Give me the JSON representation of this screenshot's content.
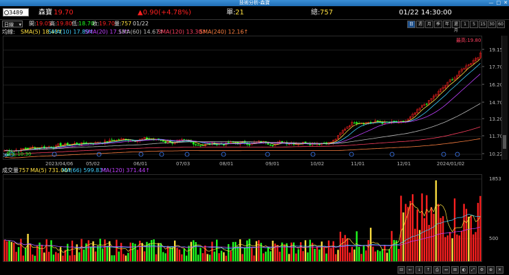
{
  "window": {
    "title": "技術分析-森寶",
    "controls": [
      "—",
      "□",
      "✕"
    ]
  },
  "header": {
    "code": "3489",
    "name": "森寶",
    "price": "19.70",
    "change": "▲0.90(+4.78%)",
    "unit_label": "單:",
    "unit_value": "21",
    "total_label": "總:",
    "total_value": "757",
    "datetime": "01/22 14:30:00"
  },
  "ohlc": {
    "period_select": "日線",
    "open_label": "開:",
    "open": "19.05",
    "high_label": "高:",
    "high": "19.80",
    "low_label": "低:",
    "low": "18.70",
    "close_label": "收:",
    "close": "19.70",
    "volume_label": "量:",
    "volume": "757",
    "date": "01/22"
  },
  "periods": [
    "日",
    "週",
    "月",
    "季",
    "年",
    "還月",
    "1",
    "5",
    "15",
    "30",
    "60"
  ],
  "active_period": 0,
  "ma_legend": {
    "label": "均線:",
    "items": [
      {
        "text": "SMA(5) 18.43↑",
        "color": "#ffe040"
      },
      {
        "text": "SMA(10) 17.89↑",
        "color": "#40d0ff"
      },
      {
        "text": "SMA(20) 17.13↑",
        "color": "#c040ff"
      },
      {
        "text": "SMA(60) 14.67↑",
        "color": "#bbbbbb"
      },
      {
        "text": "SMA(120) 13.30↑",
        "color": "#ff4060"
      },
      {
        "text": "SMA(240) 12.16↑",
        "color": "#ff8040"
      }
    ]
  },
  "price_axis": {
    "ticks": [
      "19.15",
      "17.70",
      "16.20",
      "14.70",
      "13.20",
      "11.70",
      "10.22"
    ]
  },
  "annotations": {
    "high": "最高:19.80",
    "low": "最低:10.30"
  },
  "date_axis": {
    "ticks": [
      "2023/04/06",
      "05/02",
      "06/01",
      "07/03",
      "08/01",
      "09/01",
      "10/02",
      "11/01",
      "12/01",
      "2024/01/02"
    ]
  },
  "volume_legend": {
    "label": "成交量",
    "value": "757",
    "items": [
      {
        "text": "MA(5) 731.00↑",
        "color": "#ffe040"
      },
      {
        "text": "MA(66) 599.83↑",
        "color": "#40d0ff"
      },
      {
        "text": "MA(120) 371.44↑",
        "color": "#c040ff"
      }
    ]
  },
  "volume_axis": {
    "ticks": [
      "1853",
      "500"
    ]
  },
  "colors": {
    "up": "#ff2020",
    "down": "#20ff20",
    "flat": "#ffffff"
  },
  "toolbar": [
    "⊟",
    "←",
    "↓",
    "↑",
    "⎙",
    "↔",
    "⊞",
    "◐",
    "⤢",
    "⚙",
    "⊕",
    "✕"
  ],
  "nav": "≫"
}
